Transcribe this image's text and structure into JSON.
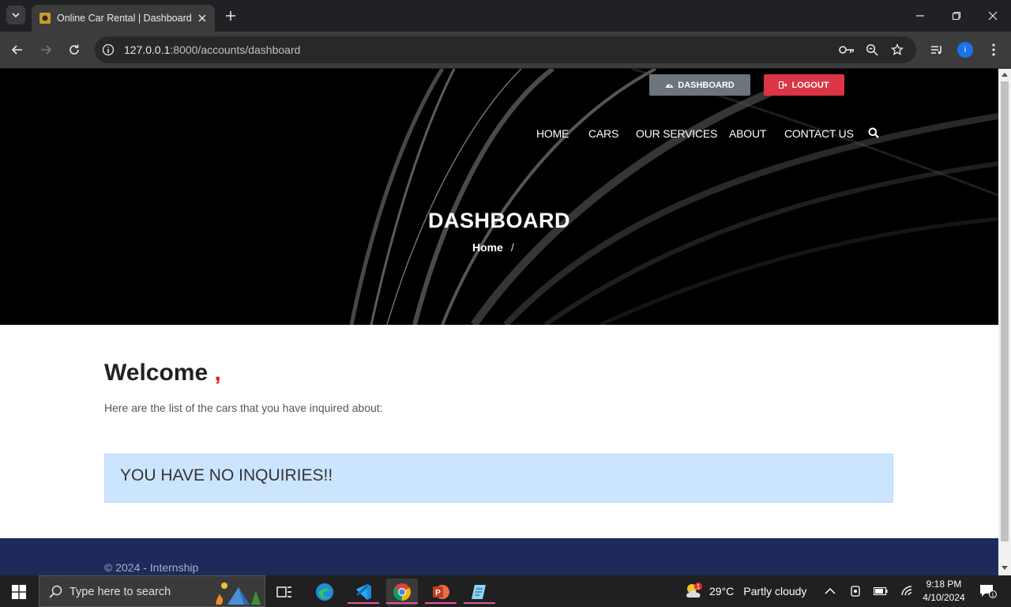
{
  "browser": {
    "tab_title": "Online Car Rental | Dashboard",
    "url_host": "127.0.0.1",
    "url_path": ":8000/accounts/dashboard"
  },
  "page": {
    "top_buttons": {
      "dashboard": "DASHBOARD",
      "logout": "LOGOUT"
    },
    "nav": [
      "HOME",
      "CARS",
      "OUR SERVICES",
      "ABOUT",
      "CONTACT US"
    ],
    "hero_title": "DASHBOARD",
    "breadcrumb": {
      "home": "Home",
      "separator": "/"
    },
    "welcome": {
      "text": "Welcome ",
      "comma": ","
    },
    "subtitle": "Here are the list of the cars that you have inquired about:",
    "alert": "YOU HAVE NO INQUIRIES!!",
    "footer": "© 2024 - Internship"
  },
  "taskbar": {
    "search_placeholder": "Type here to search",
    "weather": {
      "temp": "29°C",
      "condition": "Partly cloudy",
      "badge": "1"
    },
    "time": "9:18 PM",
    "date": "4/10/2024",
    "notification_count": "1"
  },
  "colors": {
    "dashboard_button": "#6c757d",
    "logout_button": "#dc3545",
    "alert_bg": "#cce5ff",
    "footer_bg": "#1e2a5a",
    "welcome_comma": "#e02020"
  }
}
